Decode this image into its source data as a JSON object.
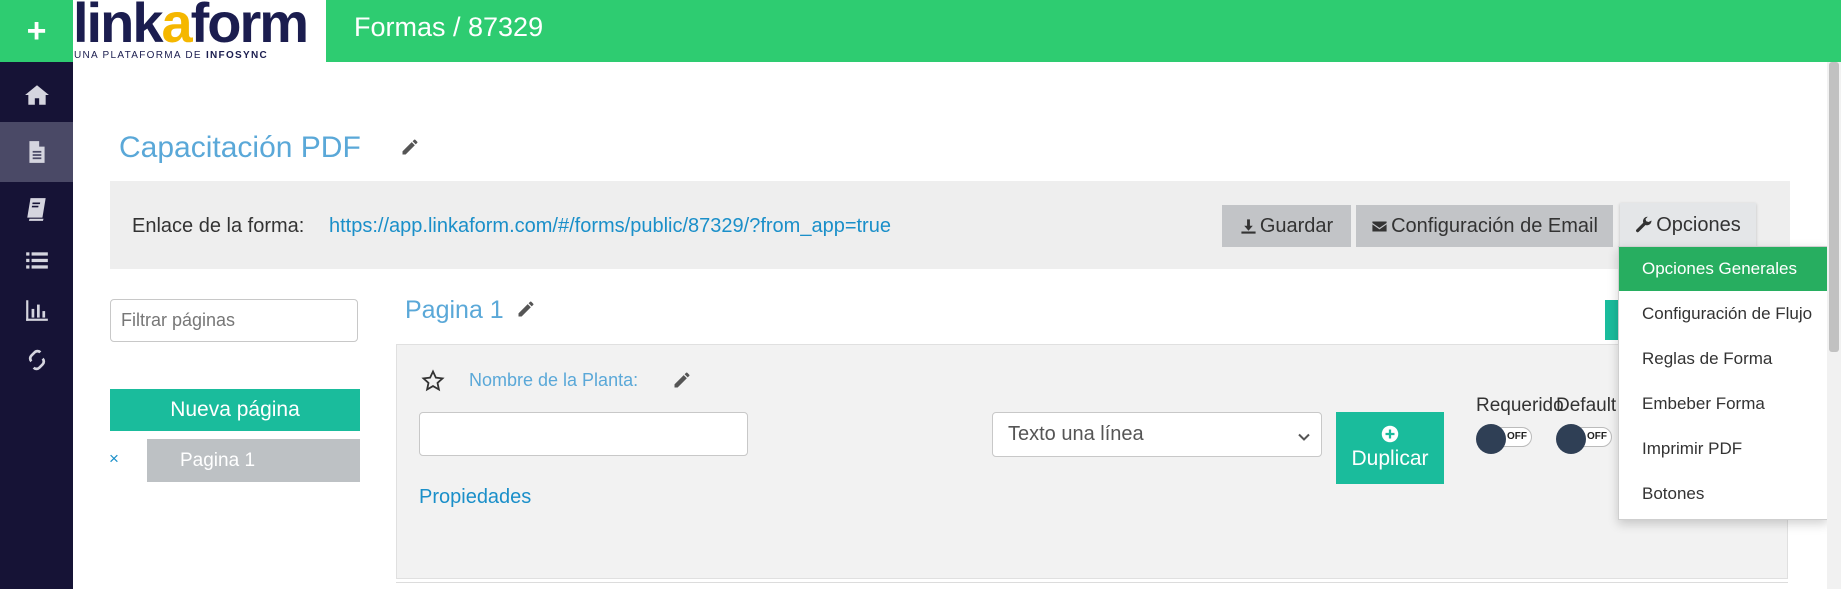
{
  "topbar": {
    "plus_label": "+",
    "logo_text_1": "link",
    "logo_text_a": "a",
    "logo_text_2": "form",
    "logo_tagline_1": "UNA PLATAFORMA DE ",
    "logo_tagline_2": "INFOSYNC",
    "breadcrumb": "Formas / 87329"
  },
  "sidebar": {
    "items": [
      {
        "icon": "home-icon",
        "active": false
      },
      {
        "icon": "document-icon",
        "active": true
      },
      {
        "icon": "book-icon",
        "active": false
      },
      {
        "icon": "list-icon",
        "active": false
      },
      {
        "icon": "bar-chart-icon",
        "active": false
      },
      {
        "icon": "link-icon",
        "active": false
      }
    ]
  },
  "form": {
    "title": "Capacitación PDF",
    "link_label": "Enlace de la forma:",
    "link_url": "https://app.linkaform.com/#/forms/public/87329/?from_app=true",
    "buttons": {
      "save": "Guardar",
      "email_config": "Configuración de Email",
      "options": "Opciones"
    }
  },
  "pages_panel": {
    "filter_placeholder": "Filtrar páginas",
    "new_page": "Nueva página",
    "remove_symbol": "×",
    "pages": [
      "Pagina 1"
    ]
  },
  "page": {
    "heading": "Pagina 1"
  },
  "field": {
    "label": "Nombre de la Planta:",
    "input_value": "",
    "type_selected": "Texto una línea",
    "duplicate": "Duplicar",
    "required_label": "Requerido",
    "default_label": "Default",
    "toggle_off": "OFF",
    "properties": "Propiedades"
  },
  "options_menu": {
    "items": [
      "Opciones Generales",
      "Configuración de Flujo",
      "Reglas de Forma",
      "Embeber Forma",
      "Imprimir PDF",
      "Botones"
    ],
    "active_index": 0
  },
  "colors": {
    "brand_green": "#2ecc71",
    "teal": "#1abc9c",
    "sidebar_bg": "#161336",
    "link_blue": "#1a8fc9",
    "title_blue": "#5aa8d8",
    "menu_active": "#27ae60"
  }
}
